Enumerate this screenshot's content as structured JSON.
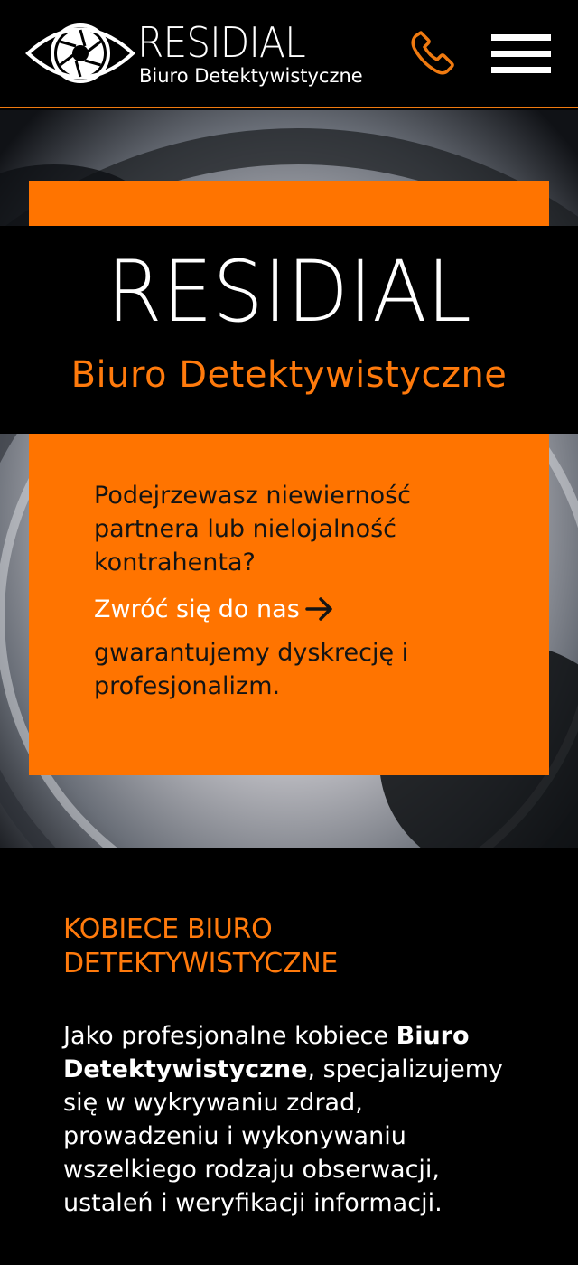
{
  "header": {
    "logo": {
      "word": "RESIDIAL",
      "subtitle": "Biuro Detektywistyczne"
    },
    "icons": {
      "logo": "eye-aperture-icon",
      "phone": "phone-icon",
      "menu": "hamburger-menu-icon"
    }
  },
  "hero": {
    "logo_word": "RESIDIAL",
    "logo_subtitle": "Biuro Detektywistyczne",
    "card": {
      "question": "Podejrzewasz niewierność partnera lub nielojalność kontrahenta?",
      "cta": "Zwróć się do nas",
      "cta_icon": "arrow-right-icon",
      "guarantee": "gwarantujemy dyskrecję i profesjonalizm."
    }
  },
  "about": {
    "heading": "KOBIECE BIURO DETEKTYWISTYCZNE",
    "text_before": "Jako profesjonalne kobiece ",
    "text_bold": "Biuro Detektywistyczne",
    "text_after": ", specjalizujemy się w wykrywaniu zdrad, prowadzeniu i wykonywaniu wszelkiego rodzaju obserwacji, ustaleń i weryfikacji informacji."
  },
  "colors": {
    "accent": "#ff7400",
    "background": "#000000",
    "text_dark": "#141414",
    "text_light": "#ffffff"
  }
}
